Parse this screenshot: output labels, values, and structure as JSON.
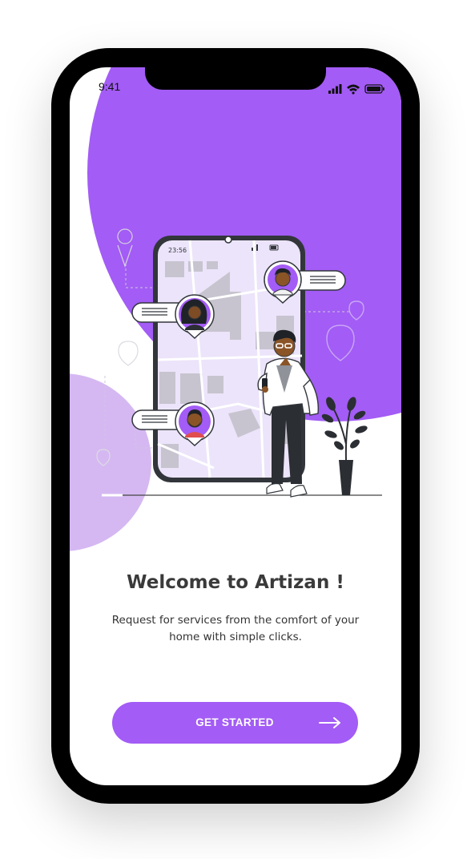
{
  "status_bar": {
    "time": "9:41",
    "icons": [
      "signal-icon",
      "wifi-icon",
      "battery-icon"
    ]
  },
  "illustration": {
    "device_time": "23:56",
    "icons": [
      "location-pin-icon",
      "avatar-woman-icon",
      "avatar-man-icon",
      "avatar-bearded-man-icon",
      "potted-plant-icon"
    ]
  },
  "welcome": {
    "title": "Welcome to Artizan !",
    "subtitle": "Request for services from the comfort of your home with simple clicks."
  },
  "cta": {
    "label": "GET STARTED",
    "icon": "arrow-right-icon"
  },
  "colors": {
    "accent": "#a35cf5",
    "accent_light": "#d5b8f2",
    "text_dark": "#3a3a3a",
    "map_bg": "#ece4fa"
  }
}
